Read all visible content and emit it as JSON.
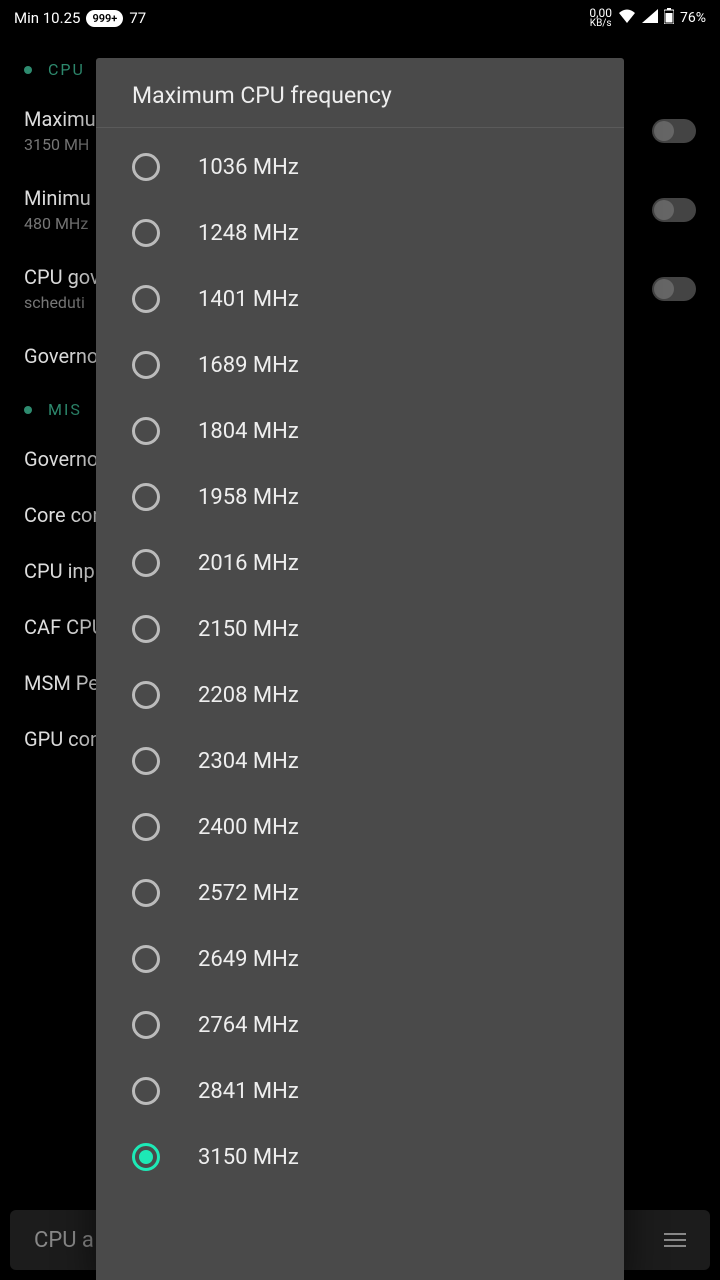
{
  "status": {
    "time": "Min 10.25",
    "badge": "999+",
    "notif": "77",
    "kbs_num": "0,00",
    "kbs_unit": "KB/s",
    "battery": "76%"
  },
  "background": {
    "section_cpu": "CPU",
    "section_misc": "MIS",
    "items": [
      {
        "title": "Maximu",
        "sub": "3150 MH",
        "toggle": true
      },
      {
        "title": "Minimu",
        "sub": "480 MHz",
        "toggle": true
      },
      {
        "title": "CPU gov",
        "sub": "scheduti",
        "toggle": true
      },
      {
        "title": "Governo",
        "sub": "",
        "toggle": false
      }
    ],
    "misc_items": [
      {
        "title": "Governo"
      },
      {
        "title": "Core con"
      },
      {
        "title": "CPU inpu"
      },
      {
        "title": "CAF CPU"
      },
      {
        "title": "MSM Per"
      },
      {
        "title": "GPU con"
      }
    ],
    "bottom_label": "CPU a"
  },
  "dialog": {
    "title": "Maximum CPU frequency",
    "selected": "3150 MHz",
    "options": [
      "1036 MHz",
      "1248 MHz",
      "1401 MHz",
      "1689 MHz",
      "1804 MHz",
      "1958 MHz",
      "2016 MHz",
      "2150 MHz",
      "2208 MHz",
      "2304 MHz",
      "2400 MHz",
      "2572 MHz",
      "2649 MHz",
      "2764 MHz",
      "2841 MHz",
      "3150 MHz"
    ]
  }
}
